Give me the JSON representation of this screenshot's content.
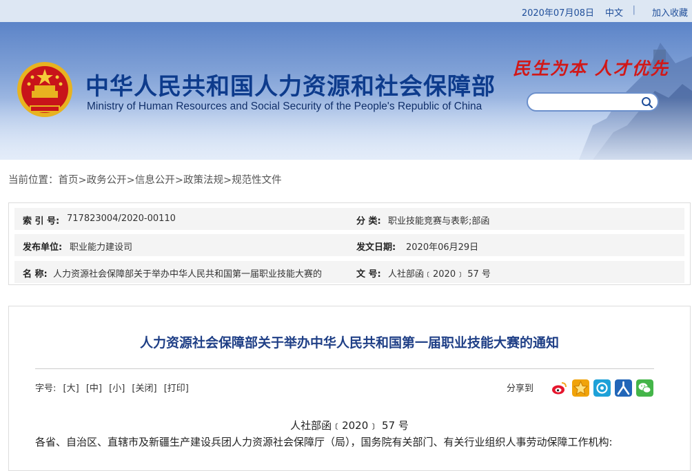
{
  "topbar": {
    "date": "2020年07月08日",
    "lang": "中文",
    "sep": "|",
    "favorite": "加入收藏"
  },
  "header": {
    "title_cn": "中华人民共和国人力资源和社会保障部",
    "title_en": "Ministry of Human Resources and Social Security of the People's Republic of China",
    "slogan": "民生为本 人才优先",
    "search_placeholder": "",
    "emblem": "national-emblem",
    "colors": {
      "brand_blue": "#0d3b8c",
      "slogan_red": "#d11818"
    }
  },
  "breadcrumb": {
    "label": "当前位置：",
    "items": [
      "首页",
      "政务公开",
      "信息公开",
      "政策法规",
      "规范性文件"
    ],
    "separator": ">"
  },
  "meta": {
    "index_label": "索 引 号:",
    "index_value": "717823004/2020-00110",
    "category_label": "分 类:",
    "category_value": "职业技能竞赛与表彰;部函",
    "publisher_label": "发布单位:",
    "publisher_value": "职业能力建设司",
    "date_label": "发文日期:",
    "date_value": "2020年06月29日",
    "name_label": "名 称:",
    "name_value": "人力资源社会保障部关于举办中华人民共和国第一届职业技能大赛的",
    "docno_label": "文 号:",
    "docno_value": "人社部函﹝2020﹞ 57 号"
  },
  "article": {
    "title": "人力资源社会保障部关于举办中华人民共和国第一届职业技能大赛的通知",
    "font_label": "字号:",
    "font_large": "[大]",
    "font_medium": "[中]",
    "font_small": "[小]",
    "close": "[关闭]",
    "print": "[打印]",
    "share_label": "分享到",
    "share_icons": [
      "weibo-icon",
      "star-icon",
      "qq-weibo-icon",
      "renren-icon",
      "wechat-icon"
    ],
    "doc_number": "人社部函﹝2020﹞ 57 号",
    "body": "各省、自治区、直辖市及新疆生产建设兵团人力资源社会保障厅（局），国务院有关部门、有关行业组织人事劳动保障工作机构:"
  }
}
